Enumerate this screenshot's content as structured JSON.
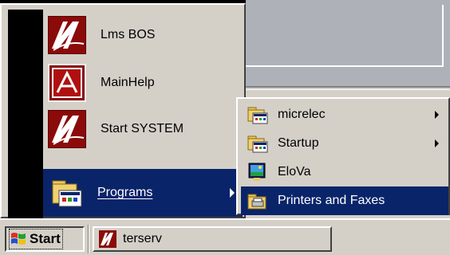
{
  "start_menu": {
    "items": [
      {
        "label": "Lms BOS",
        "icon": "lms-app-icon"
      },
      {
        "label": "MainHelp",
        "icon": "help-book-icon"
      },
      {
        "label": "Start SYSTEM",
        "icon": "lms-app-icon"
      },
      {
        "label": "Programs",
        "icon": "programs-folder-icon",
        "selected": true
      }
    ]
  },
  "programs_submenu": {
    "items": [
      {
        "label": "micrelec",
        "icon": "program-group-icon",
        "has_submenu": true
      },
      {
        "label": "Startup",
        "icon": "program-group-icon",
        "has_submenu": true
      },
      {
        "label": "EloVa",
        "icon": "elova-app-icon"
      },
      {
        "label": "Printers and Faxes",
        "icon": "printers-folder-icon",
        "selected": true
      }
    ]
  },
  "taskbar": {
    "start_label": "Start",
    "tasks": [
      {
        "label": "terserv",
        "icon": "lms-app-icon"
      }
    ]
  },
  "colors": {
    "selection": "#0a246a",
    "face": "#d4d0c8",
    "app_red": "#8b0a0a"
  }
}
